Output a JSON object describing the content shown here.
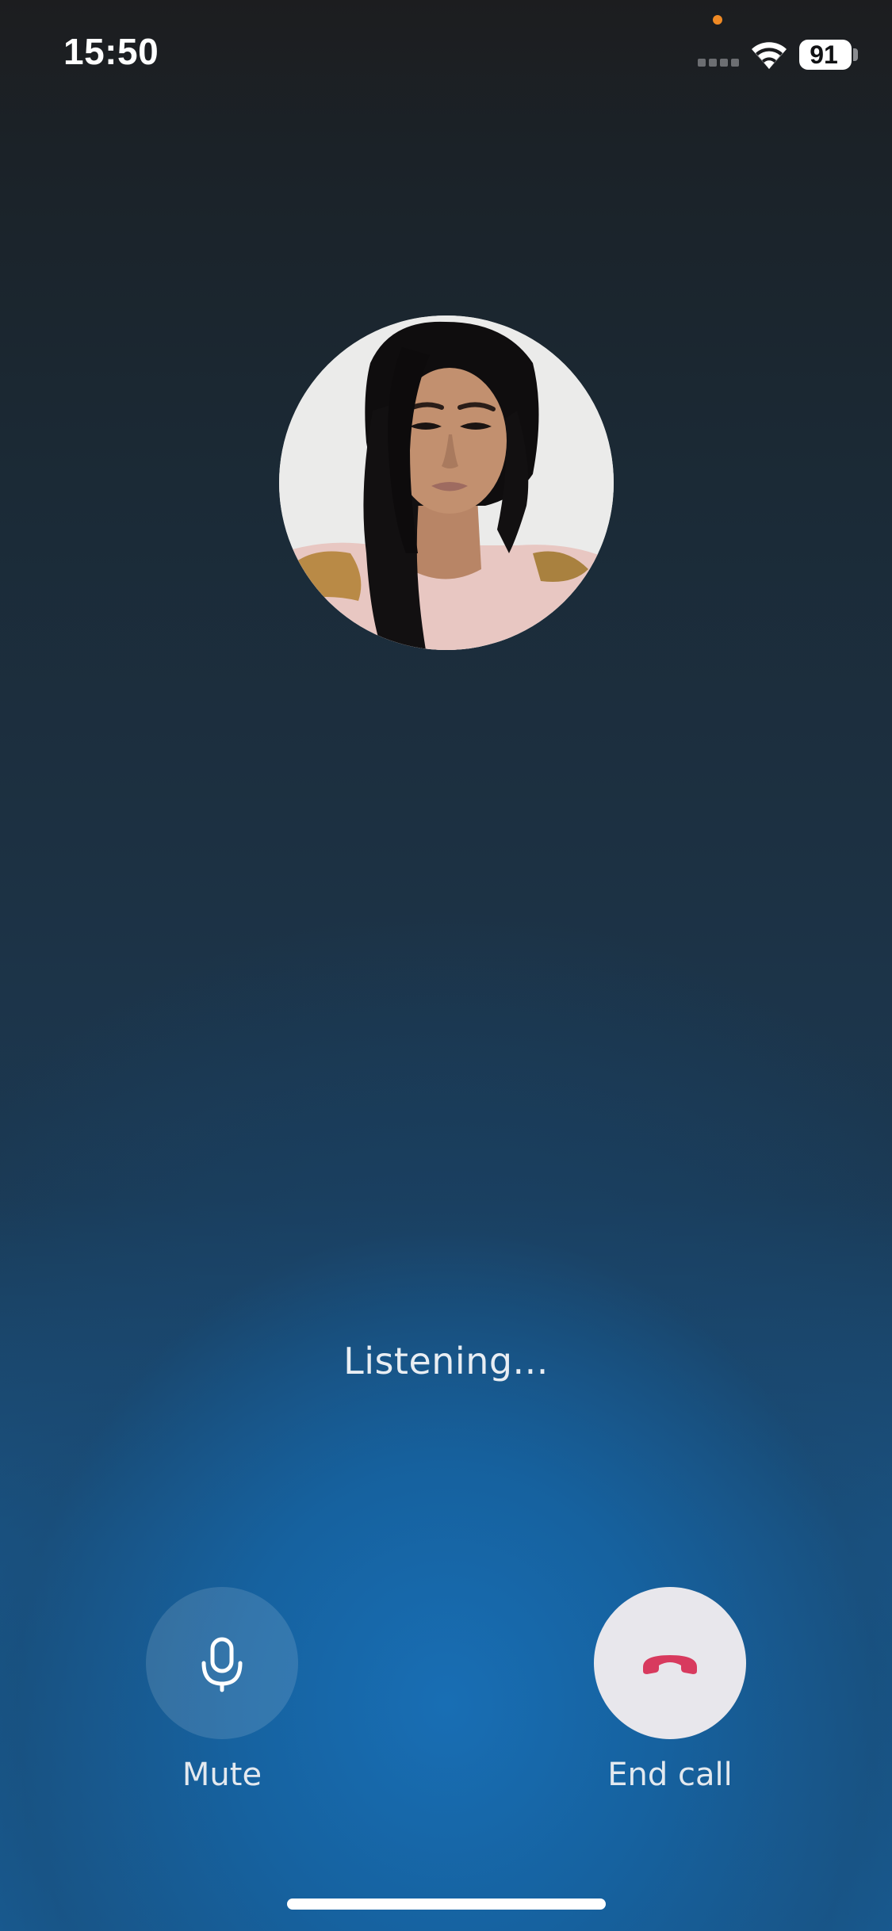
{
  "status_bar": {
    "time": "15:50",
    "battery": "91",
    "icons": [
      "signal-icon",
      "wifi-icon",
      "battery-icon"
    ],
    "privacy_indicator_color": "#f08a24"
  },
  "call": {
    "avatar": "contact-photo",
    "status": "Listening..."
  },
  "controls": {
    "mute_label": "Mute",
    "mute_icon": "microphone-icon",
    "end_label": "End call",
    "end_icon": "phone-hangup-icon",
    "end_icon_color": "#d83a5e"
  }
}
